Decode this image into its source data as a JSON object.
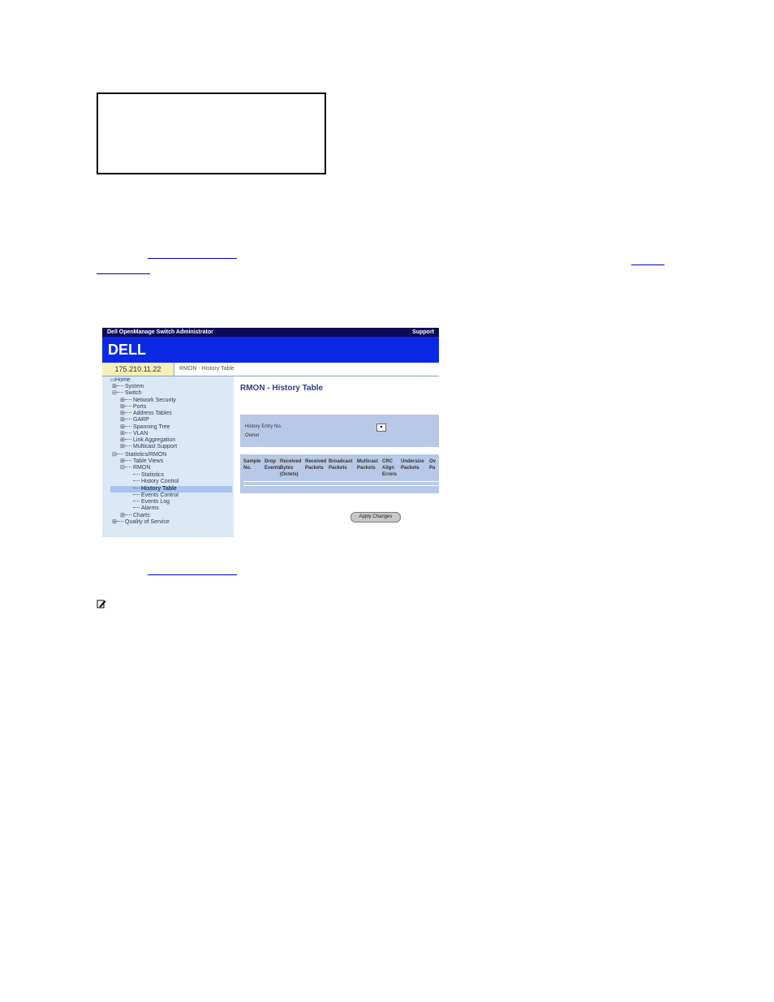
{
  "screenshot": {
    "window_title": "Dell OpenManage Switch Administrator",
    "support_link": "Support",
    "logo": "DELL",
    "ip_address": "175.210.11.22",
    "breadcrumb": "RMON - History Table",
    "tree": {
      "items": [
        {
          "label": "Home"
        },
        {
          "label": "System"
        },
        {
          "label": "Switch"
        },
        {
          "label": "Network Security"
        },
        {
          "label": "Ports"
        },
        {
          "label": "Address Tables"
        },
        {
          "label": "GARP"
        },
        {
          "label": "Spanning Tree"
        },
        {
          "label": "VLAN"
        },
        {
          "label": "Link Aggregation"
        },
        {
          "label": "Multicast Support"
        },
        {
          "label": "Statistics/RMON"
        },
        {
          "label": "Table Views"
        },
        {
          "label": "RMON"
        },
        {
          "label": "Statistics"
        },
        {
          "label": "History Control"
        },
        {
          "label": "History Table"
        },
        {
          "label": "Events Control"
        },
        {
          "label": "Events Log"
        },
        {
          "label": "Alarms"
        },
        {
          "label": "Charts"
        },
        {
          "label": "Quality of Service"
        }
      ]
    },
    "page_title": "RMON - History Table",
    "form": {
      "history_entry_label": "History Entry No.",
      "owner_label": "Owner"
    },
    "table": {
      "columns": [
        "Sample No.",
        "Drop Events",
        "Received Bytes (Octets)",
        "Received Packets",
        "Broadcast Packets",
        "Multicast Packets",
        "CRC Align Errors",
        "Undersize Packets",
        "Ov Pa"
      ]
    },
    "apply_button": "Apply Changes"
  },
  "colors": {
    "title_bar": "#0b0b58",
    "banner": "#0a28e6",
    "nav_bg": "#dbe8f6",
    "panel_bg": "#b7c9e6",
    "ip_bg": "#f5f0b8",
    "link": "#0000cc"
  },
  "icons": {
    "note": "note-pencil-icon"
  }
}
